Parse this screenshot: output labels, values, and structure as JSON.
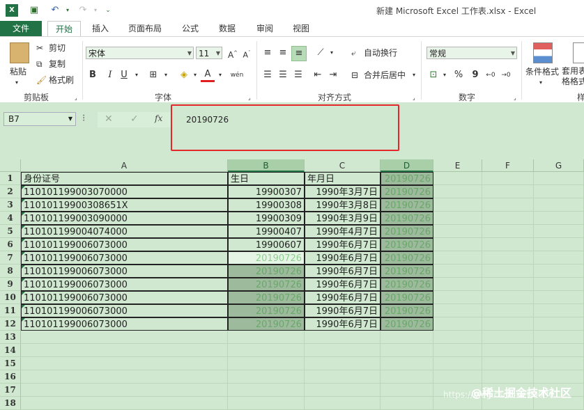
{
  "window": {
    "title": "新建 Microsoft Excel 工作表.xlsx - Excel"
  },
  "tabs": [
    "文件",
    "开始",
    "插入",
    "页面布局",
    "公式",
    "数据",
    "审阅",
    "视图"
  ],
  "ribbon": {
    "clipboard": {
      "paste": "粘贴",
      "cut": "剪切",
      "copy": "复制",
      "format_painter": "格式刷",
      "label": "剪贴板"
    },
    "font": {
      "name": "宋体",
      "size": "11",
      "bold": "B",
      "italic": "I",
      "underline": "U",
      "phonetic": "wén",
      "label": "字体"
    },
    "align": {
      "wrap": "自动换行",
      "merge": "合并后居中",
      "label": "对齐方式"
    },
    "number": {
      "format": "常规",
      "percent": "%",
      "comma": "9",
      "label": "数字"
    },
    "styles": {
      "conditional": "条件格式",
      "table_format": "套用表格格式",
      "label": "样"
    }
  },
  "formula_bar": {
    "name_box": "B7",
    "fx": "fx",
    "value": "20190726"
  },
  "columns": [
    "A",
    "B",
    "C",
    "D",
    "E",
    "F",
    "G"
  ],
  "rows": [
    {
      "n": "1",
      "a": "身份证号",
      "b": "生日",
      "c": "年月日",
      "d": "20190726"
    },
    {
      "n": "2",
      "a": "110101199003070000",
      "b": "19900307",
      "c": "1990年3月7日",
      "d": "20190726"
    },
    {
      "n": "3",
      "a": "11010119900308651X",
      "b": "19900308",
      "c": "1990年3月8日",
      "d": "20190726"
    },
    {
      "n": "4",
      "a": "110101199003090000",
      "b": "19900309",
      "c": "1990年3月9日",
      "d": "20190726"
    },
    {
      "n": "5",
      "a": "110101199004074000",
      "b": "19900407",
      "c": "1990年4月7日",
      "d": "20190726"
    },
    {
      "n": "6",
      "a": "110101199006073000",
      "b": "19900607",
      "c": "1990年6月7日",
      "d": "20190726"
    },
    {
      "n": "7",
      "a": "110101199006073000",
      "b": "20190726",
      "c": "1990年6月7日",
      "d": "20190726"
    },
    {
      "n": "8",
      "a": "110101199006073000",
      "b": "20190726",
      "c": "1990年6月7日",
      "d": "20190726"
    },
    {
      "n": "9",
      "a": "110101199006073000",
      "b": "20190726",
      "c": "1990年6月7日",
      "d": "20190726"
    },
    {
      "n": "10",
      "a": "110101199006073000",
      "b": "20190726",
      "c": "1990年6月7日",
      "d": "20190726"
    },
    {
      "n": "11",
      "a": "110101199006073000",
      "b": "20190726",
      "c": "1990年6月7日",
      "d": "20190726"
    },
    {
      "n": "12",
      "a": "110101199006073000",
      "b": "20190726",
      "c": "1990年6月7日",
      "d": "20190726"
    }
  ],
  "empty_rows": [
    "13",
    "14",
    "15",
    "16",
    "17",
    "18"
  ],
  "watermark": {
    "brand": "@稀土掘金技术社区",
    "url": "https://blog.csdn.net/u0301..."
  },
  "colors": {
    "accent": "#217346",
    "highlight": "#e5262a"
  }
}
